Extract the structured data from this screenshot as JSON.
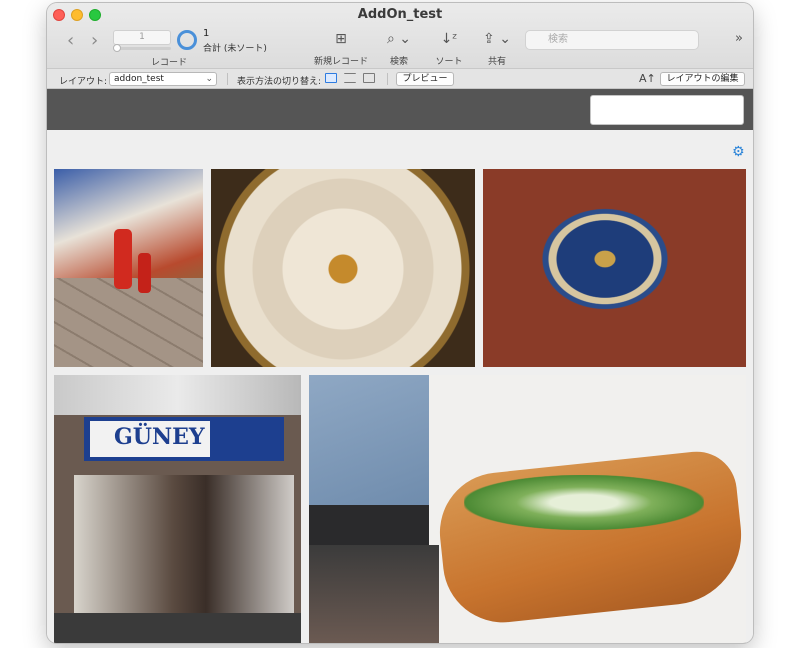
{
  "window": {
    "title": "AddOn_test"
  },
  "toolbar": {
    "back_icon": "chevron-left",
    "forward_icon": "chevron-right",
    "record_current": "1",
    "record_label": "レコード",
    "found_count": "1",
    "found_summary": "合計 (未ソート)",
    "new_record_label": "新規レコード",
    "find_label": "検索",
    "sort_label": "ソート",
    "share_label": "共有",
    "search_placeholder": "検索",
    "overflow_icon": "chevron-double-right"
  },
  "layout_bar": {
    "layout_label": "レイアウト:",
    "layout_value": "addon_test",
    "view_label": "表示方法の切り替え:",
    "preview_button": "プレビュー",
    "edit_layout_button": "レイアウトの編集",
    "text_format_icon": "A↑"
  },
  "content": {
    "settings_icon": "gear",
    "photos": [
      {
        "subject": "fire-extinguisher-tiles"
      },
      {
        "subject": "dome-ceiling"
      },
      {
        "subject": "ornamental-ceiling"
      },
      {
        "subject": "guney-shopfront",
        "sign_text": "GÜNEY"
      },
      {
        "subject": "fish-sandwich"
      }
    ]
  },
  "colors": {
    "accent": "#2b84d8",
    "dark_band": "#555555",
    "close": "#fe5f57",
    "minimize": "#febc2e",
    "maximize": "#28c840"
  }
}
